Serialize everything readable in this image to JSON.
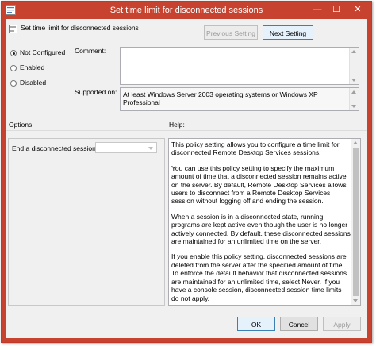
{
  "window": {
    "title": "Set time limit for disconnected sessions",
    "minimize_glyph": "—",
    "maximize_glyph": "☐",
    "close_glyph": "✕"
  },
  "header": {
    "policy_name": "Set time limit for disconnected sessions",
    "icon": "policy-setting-icon"
  },
  "nav": {
    "previous_label": "Previous Setting",
    "next_label": "Next Setting"
  },
  "state": {
    "options": [
      {
        "label": "Not Configured",
        "selected": true
      },
      {
        "label": "Enabled",
        "selected": false
      },
      {
        "label": "Disabled",
        "selected": false
      }
    ]
  },
  "comment": {
    "label": "Comment:",
    "value": ""
  },
  "supported": {
    "label": "Supported on:",
    "value": "At least Windows Server 2003 operating systems or Windows XP Professional"
  },
  "options_panel": {
    "label": "Options:",
    "end_session_label": "End a disconnected session",
    "end_session_value": ""
  },
  "help": {
    "label": "Help:",
    "paragraphs": [
      "This policy setting allows you to configure a time limit for disconnected Remote Desktop Services sessions.",
      "You can use this policy setting to specify the maximum amount of time that a disconnected session remains active on the server. By default, Remote Desktop Services allows users to disconnect from a Remote Desktop Services session without logging off and ending the session.",
      "When a session is in a disconnected state, running programs are kept active even though the user is no longer actively connected. By default, these disconnected sessions are maintained for an unlimited time on the server.",
      "If you enable this policy setting, disconnected sessions are deleted from the server after the specified amount of time. To enforce the default behavior that disconnected sessions are maintained for an unlimited time, select Never. If you have a console session, disconnected session time limits do not apply."
    ]
  },
  "buttons": {
    "ok": "OK",
    "cancel": "Cancel",
    "apply": "Apply"
  },
  "colors": {
    "titlebar": "#c8432f",
    "dialog": "#f0f0f0",
    "default_button_border": "#3c7fb1"
  }
}
